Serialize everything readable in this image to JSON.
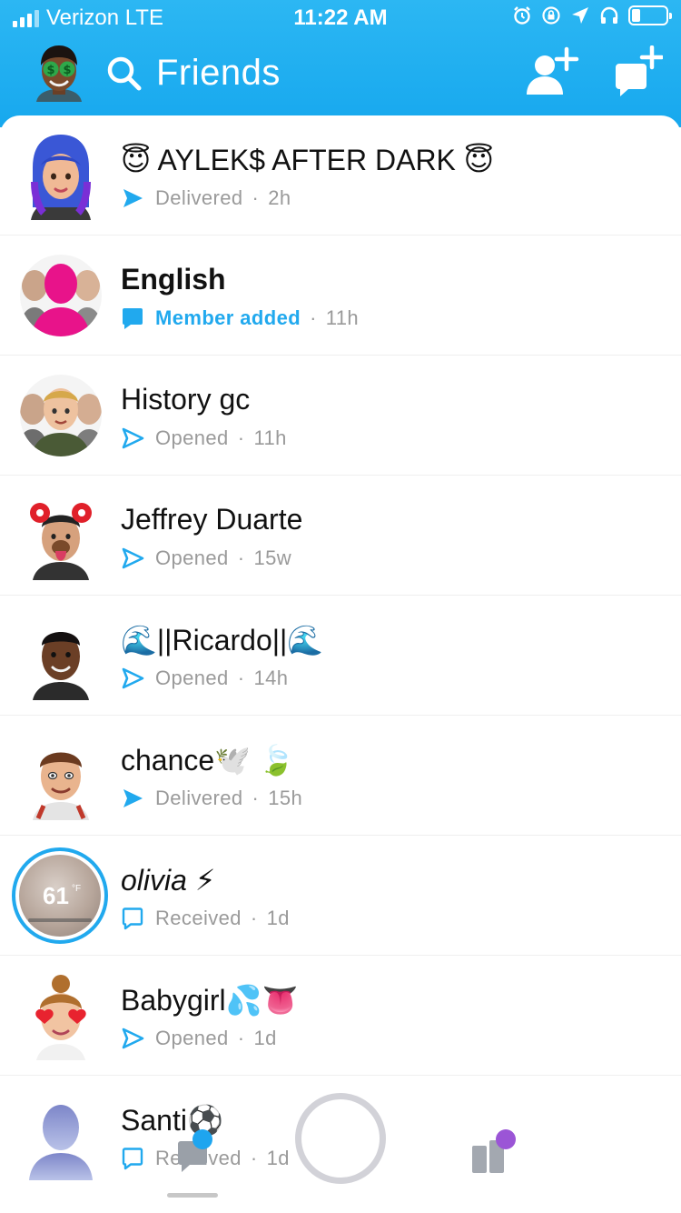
{
  "status_bar": {
    "carrier": "Verizon LTE",
    "time": "11:22 AM"
  },
  "header": {
    "title": "Friends",
    "icons": {
      "avatar": "bitmoji-avatar-icon",
      "search": "search-icon",
      "add_friend": "add-friend-icon",
      "new_chat": "new-chat-icon"
    }
  },
  "colors": {
    "header_gradient_top": "#2cb7f3",
    "header_gradient_bottom": "#17a8ee",
    "accent_blue": "#21a9ee",
    "muted_gray": "#9a9a9a",
    "group_pink": "#e8138a",
    "discover_purple": "#9b55d6"
  },
  "conversations": [
    {
      "name": "AYLEK$ AFTER DARK",
      "name_prefix_emoji": "😇",
      "name_suffix_emoji": "😇",
      "status": "Delivered",
      "time": "2h",
      "status_icon": "filled-arrow-icon"
    },
    {
      "name": "English",
      "status": "Member added",
      "time": "11h",
      "status_icon": "filled-chat-icon"
    },
    {
      "name": "History gc",
      "status": "Opened",
      "time": "11h",
      "status_icon": "outline-arrow-icon"
    },
    {
      "name": "Jeffrey Duarte",
      "status": "Opened",
      "time": "15w",
      "status_icon": "outline-arrow-icon"
    },
    {
      "name": "||Ricardo||",
      "name_prefix_emoji": "🌊",
      "name_suffix_emoji": "🌊",
      "status": "Opened",
      "time": "14h",
      "status_icon": "outline-arrow-icon"
    },
    {
      "name": "chance",
      "name_suffix_emoji": "🕊️ 🍃",
      "status": "Delivered",
      "time": "15h",
      "status_icon": "filled-arrow-icon"
    },
    {
      "name": "olivia",
      "name_suffix_emoji": "⚡",
      "status": "Received",
      "time": "1d",
      "status_icon": "outline-chat-icon",
      "story_temp": "61",
      "story_unit": "°F"
    },
    {
      "name": "Babygirl",
      "name_suffix_emoji": "💦👅",
      "status": "Opened",
      "time": "1d",
      "status_icon": "outline-arrow-icon"
    },
    {
      "name": "Santi",
      "name_suffix_emoji": "⚽",
      "status": "Received",
      "time": "1d",
      "status_icon": "outline-chat-icon"
    }
  ],
  "bottom_bar": {
    "icons": [
      "chat-icon",
      "capture-button",
      "discover-icon"
    ]
  }
}
